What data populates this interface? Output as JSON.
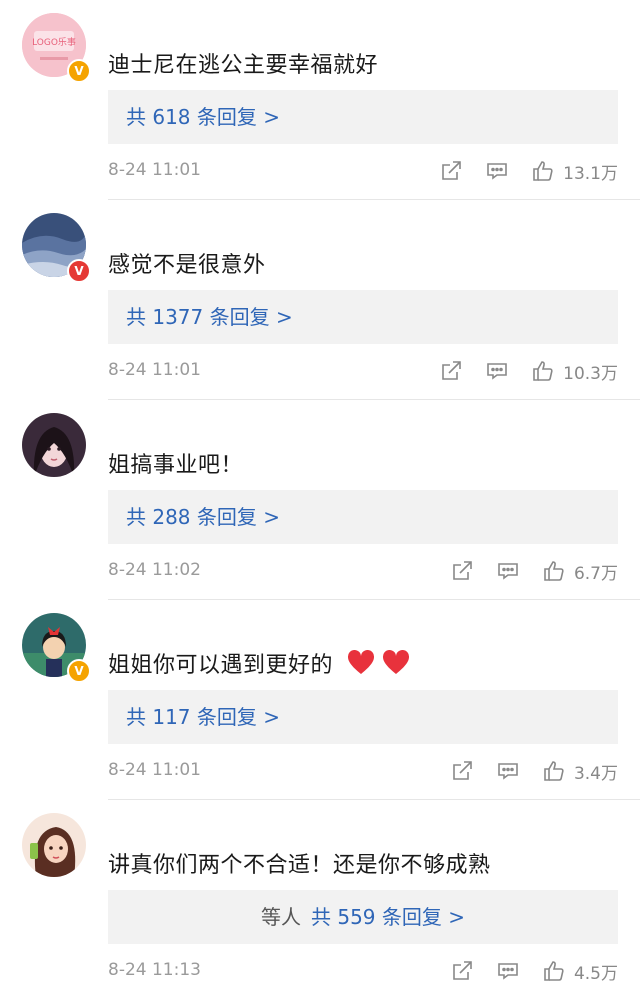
{
  "comments": [
    {
      "text": "迪士尼在逃公主要幸福就好",
      "replies": "共 618 条回复 >",
      "time": "8-24 11:01",
      "likes": "13.1万",
      "badge": "V",
      "avatar_logo": "LOGO乐事"
    },
    {
      "text": "感觉不是很意外",
      "replies": "共 1377 条回复 >",
      "time": "8-24 11:01",
      "likes": "10.3万",
      "badge": "V"
    },
    {
      "text": "姐搞事业吧！",
      "replies": "共 288 条回复 >",
      "time": "8-24 11:02",
      "likes": "6.7万"
    },
    {
      "text": "姐姐你可以遇到更好的",
      "replies": "共 117 条回复 >",
      "time": "8-24 11:01",
      "likes": "3.4万",
      "badge": "V"
    },
    {
      "text": "讲真你们两个不合适！还是你不够成熟",
      "replies_prefix": "等人",
      "replies": "共 559 条回复 >",
      "time": "8-24 11:13",
      "likes": "4.5万"
    }
  ],
  "icons": [
    "share-icon",
    "comment-icon",
    "like-icon"
  ],
  "colors": {
    "link": "#2f66b7",
    "reply_bg": "#f2f2f2",
    "meta": "#9a9a9a",
    "heart": "#e8323c"
  }
}
